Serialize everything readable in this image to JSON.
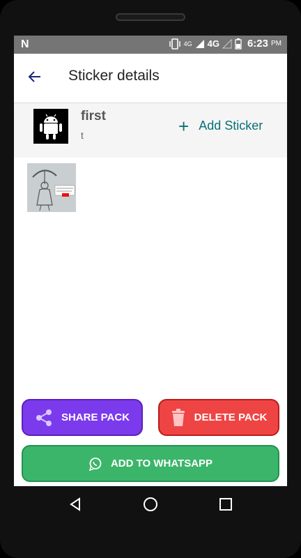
{
  "status": {
    "network_letter": "N",
    "lte_label": "4G",
    "network_label": "4G",
    "time": "6:23",
    "ampm": "PM"
  },
  "appbar": {
    "title": "Sticker details"
  },
  "pack": {
    "name": "first",
    "publisher": "t",
    "add_sticker_label": "Add Sticker"
  },
  "actions": {
    "share_label": "SHARE PACK",
    "delete_label": "DELETE PACK",
    "whatsapp_label": "ADD TO WHATSAPP"
  },
  "colors": {
    "share": "#7c3aed",
    "delete": "#ef4444",
    "whatsapp": "#3bb56a",
    "accent": "#0a6f78"
  }
}
